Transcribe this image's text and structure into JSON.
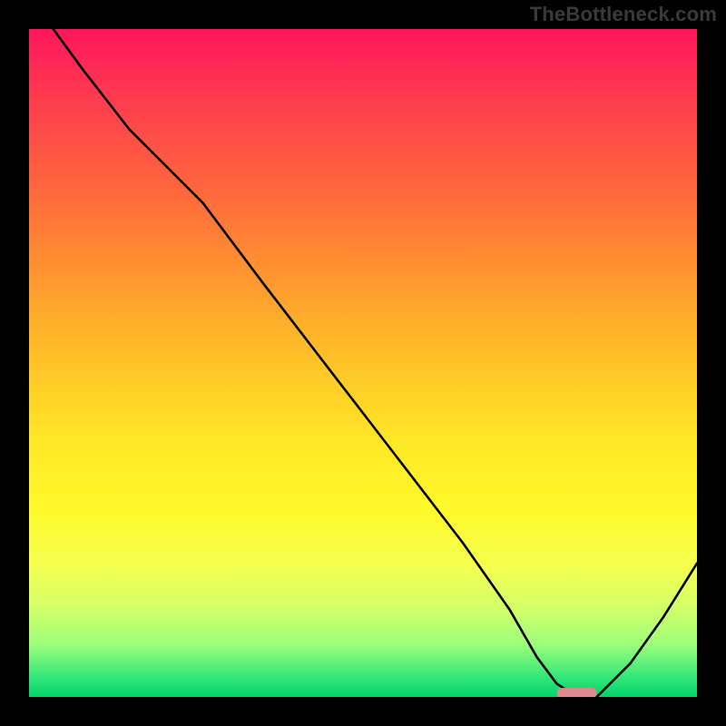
{
  "watermark": "TheBottleneck.com",
  "chart_data": {
    "type": "line",
    "title": "",
    "xlabel": "",
    "ylabel": "",
    "xlim": [
      0,
      100
    ],
    "ylim": [
      0,
      100
    ],
    "grid": false,
    "legend": false,
    "series": [
      {
        "name": "curve",
        "x": [
          0,
          8,
          15,
          22,
          26,
          35,
          45,
          55,
          65,
          72,
          76,
          79,
          82,
          85,
          90,
          95,
          100
        ],
        "y": [
          105,
          94,
          85,
          78,
          74,
          62,
          49,
          36,
          23,
          13,
          6,
          2,
          0,
          0,
          5,
          12,
          20
        ]
      }
    ],
    "marker": {
      "name": "highlight-segment",
      "x_start": 79,
      "x_end": 85,
      "y": 0,
      "color": "#e08a8f"
    },
    "background": {
      "type": "vertical-gradient",
      "stops": [
        {
          "pos": 0,
          "color": "#ff165c"
        },
        {
          "pos": 25,
          "color": "#ff6a3c"
        },
        {
          "pos": 50,
          "color": "#ffc327"
        },
        {
          "pos": 72,
          "color": "#fff92a"
        },
        {
          "pos": 92,
          "color": "#9fff7a"
        },
        {
          "pos": 100,
          "color": "#00d36a"
        }
      ]
    }
  }
}
